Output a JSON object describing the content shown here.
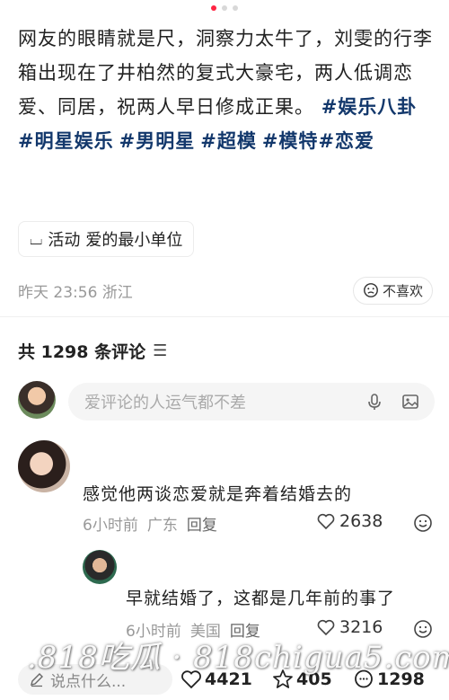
{
  "carousel": {
    "total": 3,
    "active_index": 0
  },
  "post": {
    "text": "网友的眼睛就是尺，洞察力太牛了，刘雯的行李箱出现在了井柏然的复式大豪宅，两人低调恋爱、同居，祝两人早日修成正果。",
    "tags": [
      "#娱乐八卦",
      "#明星娱乐",
      "#男明星",
      "#超模",
      "#模特",
      "#恋爱"
    ],
    "activity_label": "活动",
    "activity_name": "爱的最小单位",
    "meta": "昨天 23:56 浙江",
    "dislike_label": "不喜欢"
  },
  "comments_section": {
    "header": "共 1298 条评论",
    "input_placeholder": "爱评论的人运气都不差"
  },
  "comments": [
    {
      "text": "感觉他两谈恋爱就是奔着结婚去的",
      "time": "6小时前",
      "location": "广东",
      "reply": "回复",
      "likes": "2638"
    },
    {
      "text": "早就结婚了，这都是几年前的事了",
      "time": "6小时前",
      "location": "美国",
      "reply": "回复",
      "likes": "3216"
    }
  ],
  "bottom_bar": {
    "input_placeholder": "说点什么...",
    "likes": "4421",
    "favorites": "405",
    "comments": "1298"
  },
  "watermark": ".818吃瓜 · 818chigua5.com",
  "colors": {
    "tag": "#13386c",
    "accent": "#ff2442",
    "muted": "#999999"
  }
}
